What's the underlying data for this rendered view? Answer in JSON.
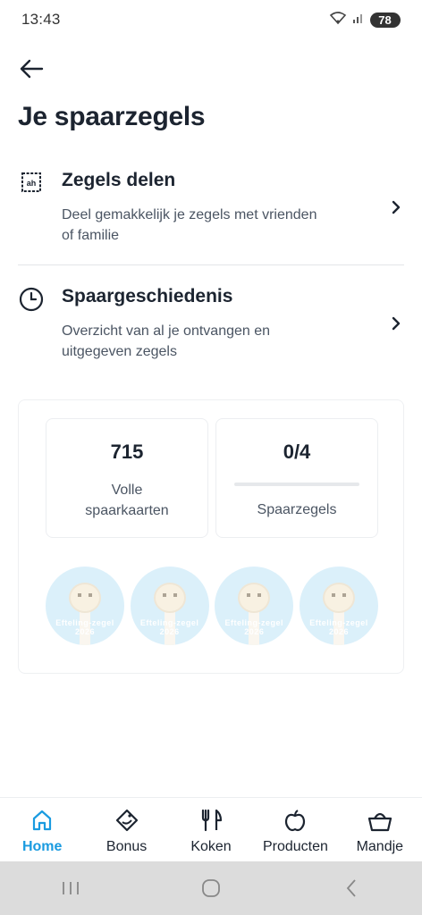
{
  "status_bar": {
    "time": "13:43",
    "battery": "78"
  },
  "header": {
    "title": "Je spaarzegels"
  },
  "menu": [
    {
      "title": "Zegels delen",
      "description": "Deel gemakkelijk je zegels met vrienden of familie",
      "icon": "share-stamp-icon"
    },
    {
      "title": "Spaargeschiedenis",
      "description": "Overzicht van al je ontvangen en uitgegeven zegels",
      "icon": "clock-icon"
    }
  ],
  "stats": {
    "full_cards": {
      "value": "715",
      "label": "Volle spaarkaarten"
    },
    "stamps": {
      "value": "0/4",
      "label": "Spaarzegels",
      "progress": 0
    }
  },
  "stamps": [
    {
      "text": "Efteling-zegel 2026"
    },
    {
      "text": "Efteling-zegel 2026"
    },
    {
      "text": "Efteling-zegel 2026"
    },
    {
      "text": "Efteling-zegel 2026"
    }
  ],
  "bottom_nav": [
    {
      "label": "Home",
      "icon": "home-icon",
      "active": true
    },
    {
      "label": "Bonus",
      "icon": "tag-icon",
      "active": false
    },
    {
      "label": "Koken",
      "icon": "fork-knife-icon",
      "active": false
    },
    {
      "label": "Producten",
      "icon": "apple-icon",
      "active": false
    },
    {
      "label": "Mandje",
      "icon": "basket-icon",
      "active": false
    }
  ],
  "colors": {
    "accent": "#1a9be0",
    "text": "#1c2430",
    "muted": "#4b5563"
  }
}
